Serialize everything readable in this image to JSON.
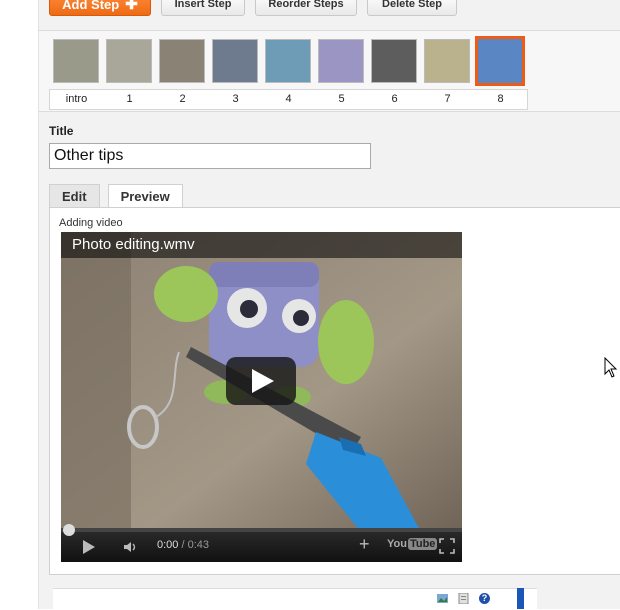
{
  "toolbar": {
    "add_step_label": "Add Step",
    "insert_step_label": "Insert Step",
    "reorder_steps_label": "Reorder Steps",
    "delete_step_label": "Delete Step"
  },
  "steps": [
    {
      "label": "intro",
      "color": "#9a9a8a"
    },
    {
      "label": "1",
      "color": "#a8a79a"
    },
    {
      "label": "2",
      "color": "#8a8275"
    },
    {
      "label": "3",
      "color": "#6e7a8e"
    },
    {
      "label": "4",
      "color": "#6e9cb6"
    },
    {
      "label": "5",
      "color": "#9b95c4"
    },
    {
      "label": "6",
      "color": "#5d5d5d"
    },
    {
      "label": "7",
      "color": "#b9b28d"
    },
    {
      "label": "8",
      "color": "#5a86c4"
    }
  ],
  "selected_step": "8",
  "title": {
    "label": "Title",
    "value": "Other tips"
  },
  "tabs": [
    {
      "label": "Edit"
    },
    {
      "label": "Preview"
    }
  ],
  "active_tab": "Preview",
  "preview": {
    "caption": "Adding video",
    "video_title": "Photo editing.wmv",
    "current_time": "0:00",
    "duration": "/ 0:43",
    "progress": 0,
    "youtube_logo_you": "You",
    "youtube_logo_tube": "Tube"
  },
  "colors": {
    "accent": "#ef5a14",
    "selected_border": "#ef5a14",
    "panel_bg": "#f2f2f2",
    "help_blue": "#1f4fa8"
  },
  "icons": {
    "add": "plus-icon",
    "play": "play-icon",
    "volume": "volume-icon",
    "fullscreen": "fullscreen-icon",
    "help": "help-icon"
  }
}
